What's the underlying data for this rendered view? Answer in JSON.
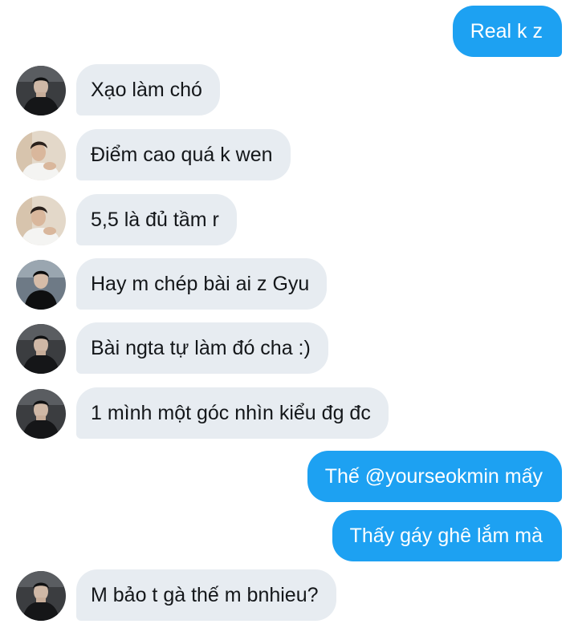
{
  "messages": [
    {
      "side": "out",
      "text": "Real k z"
    },
    {
      "side": "in",
      "avatar": "dark-jacket-avatar",
      "text": "Xạo làm chó"
    },
    {
      "side": "in",
      "avatar": "white-shirt-avatar",
      "text": "Điểm cao quá k wen"
    },
    {
      "side": "in",
      "avatar": "white-shirt-avatar",
      "text": "5,5 là đủ tầm r"
    },
    {
      "side": "in",
      "avatar": "black-tee-avatar",
      "text": "Hay m chép bài ai z Gyu"
    },
    {
      "side": "in",
      "avatar": "dark-jacket-avatar",
      "text": "Bài ngta tự làm đó cha :)"
    },
    {
      "side": "in",
      "avatar": "dark-jacket-avatar",
      "text": "1 mình một góc nhìn kiểu đg đc"
    },
    {
      "side": "out",
      "text": "Thế @yourseokmin mấy"
    },
    {
      "side": "out",
      "text": "Thấy gáy ghê lắm mà"
    },
    {
      "side": "in",
      "avatar": "dark-jacket-avatar",
      "text": "M bảo t gà thế m bnhieu?"
    }
  ],
  "colors": {
    "outgoing_bubble": "#1da1f2",
    "incoming_bubble": "#e7ecf1",
    "incoming_text": "#14171a",
    "outgoing_text": "#ffffff"
  }
}
